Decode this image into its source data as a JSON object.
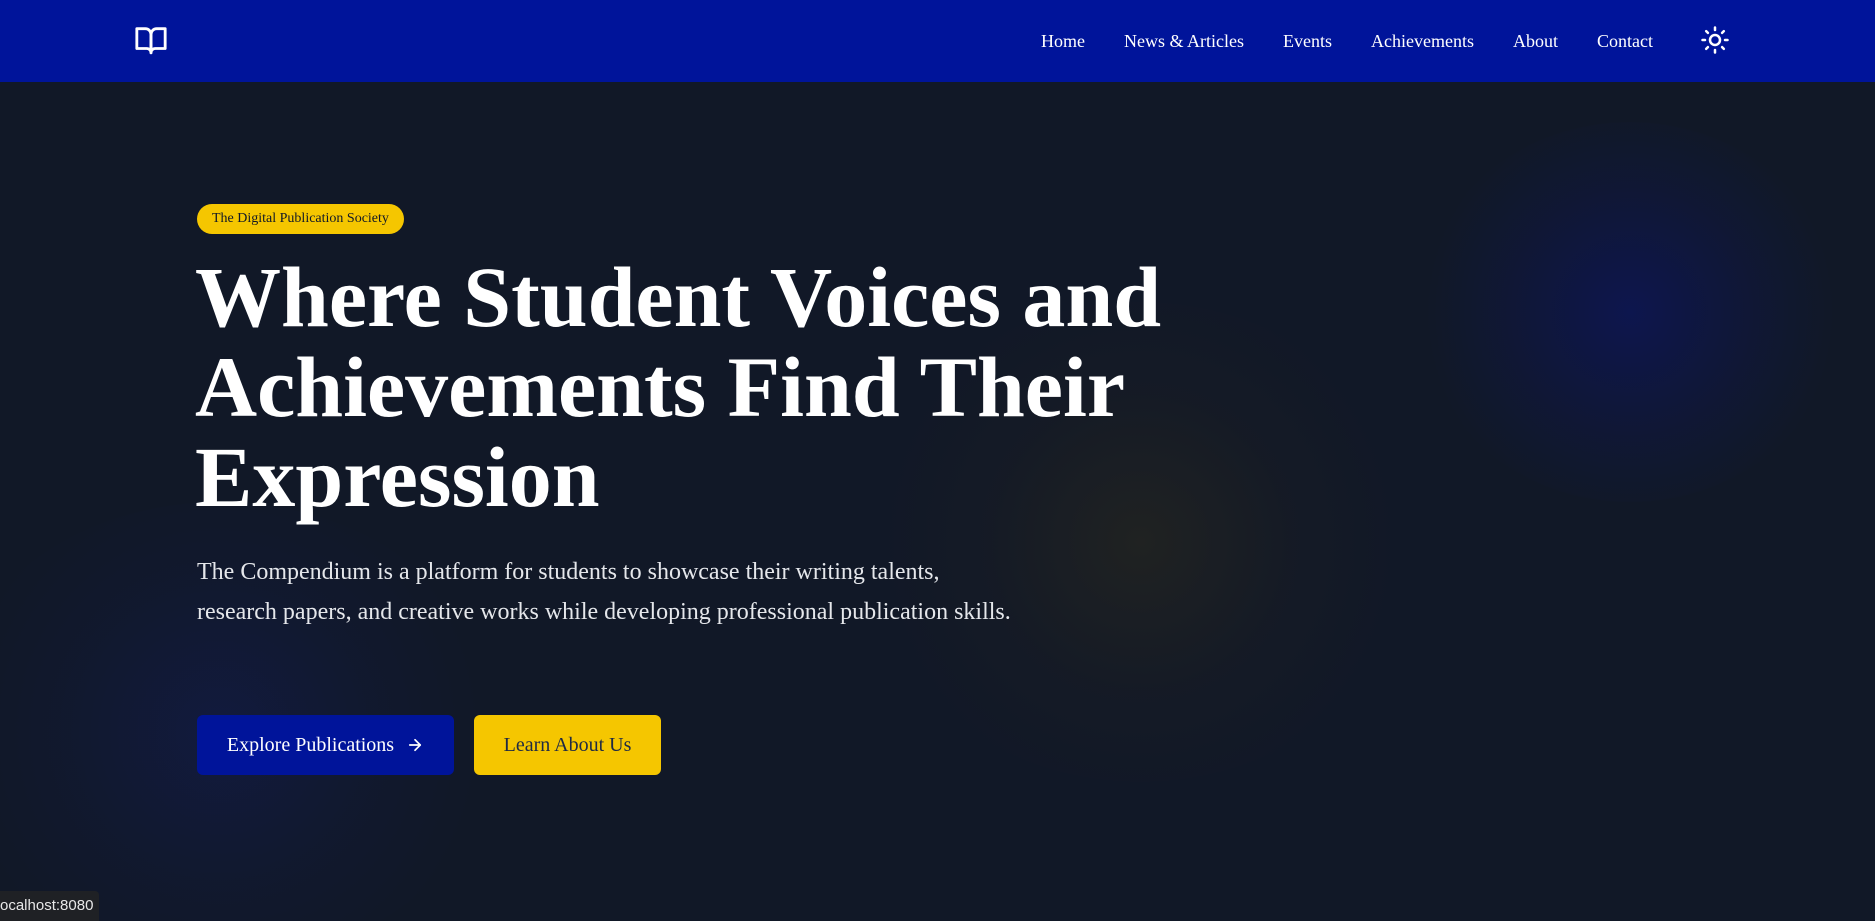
{
  "navbar": {
    "logo_icon": "open-book-icon",
    "links": [
      {
        "label": "Home"
      },
      {
        "label": "News & Articles"
      },
      {
        "label": "Events"
      },
      {
        "label": "Achievements"
      },
      {
        "label": "About"
      },
      {
        "label": "Contact"
      }
    ],
    "theme_toggle_icon": "sun-icon"
  },
  "hero": {
    "tagline": "The Digital Publication Society",
    "title": "Where Student Voices and Achievements Find Their Expression",
    "subtitle": "The Compendium is a platform for students to showcase their writing talents, research papers, and creative works while developing professional publication skills.",
    "primary_button": {
      "label": "Explore Publications",
      "icon": "arrow-right-icon"
    },
    "secondary_button": {
      "label": "Learn About Us"
    }
  },
  "status_bar": {
    "url": "ocalhost:8080"
  },
  "colors": {
    "nav_background": "#00149a",
    "page_background": "#111827",
    "accent_yellow": "#f5c600",
    "text_white": "#ffffff"
  }
}
